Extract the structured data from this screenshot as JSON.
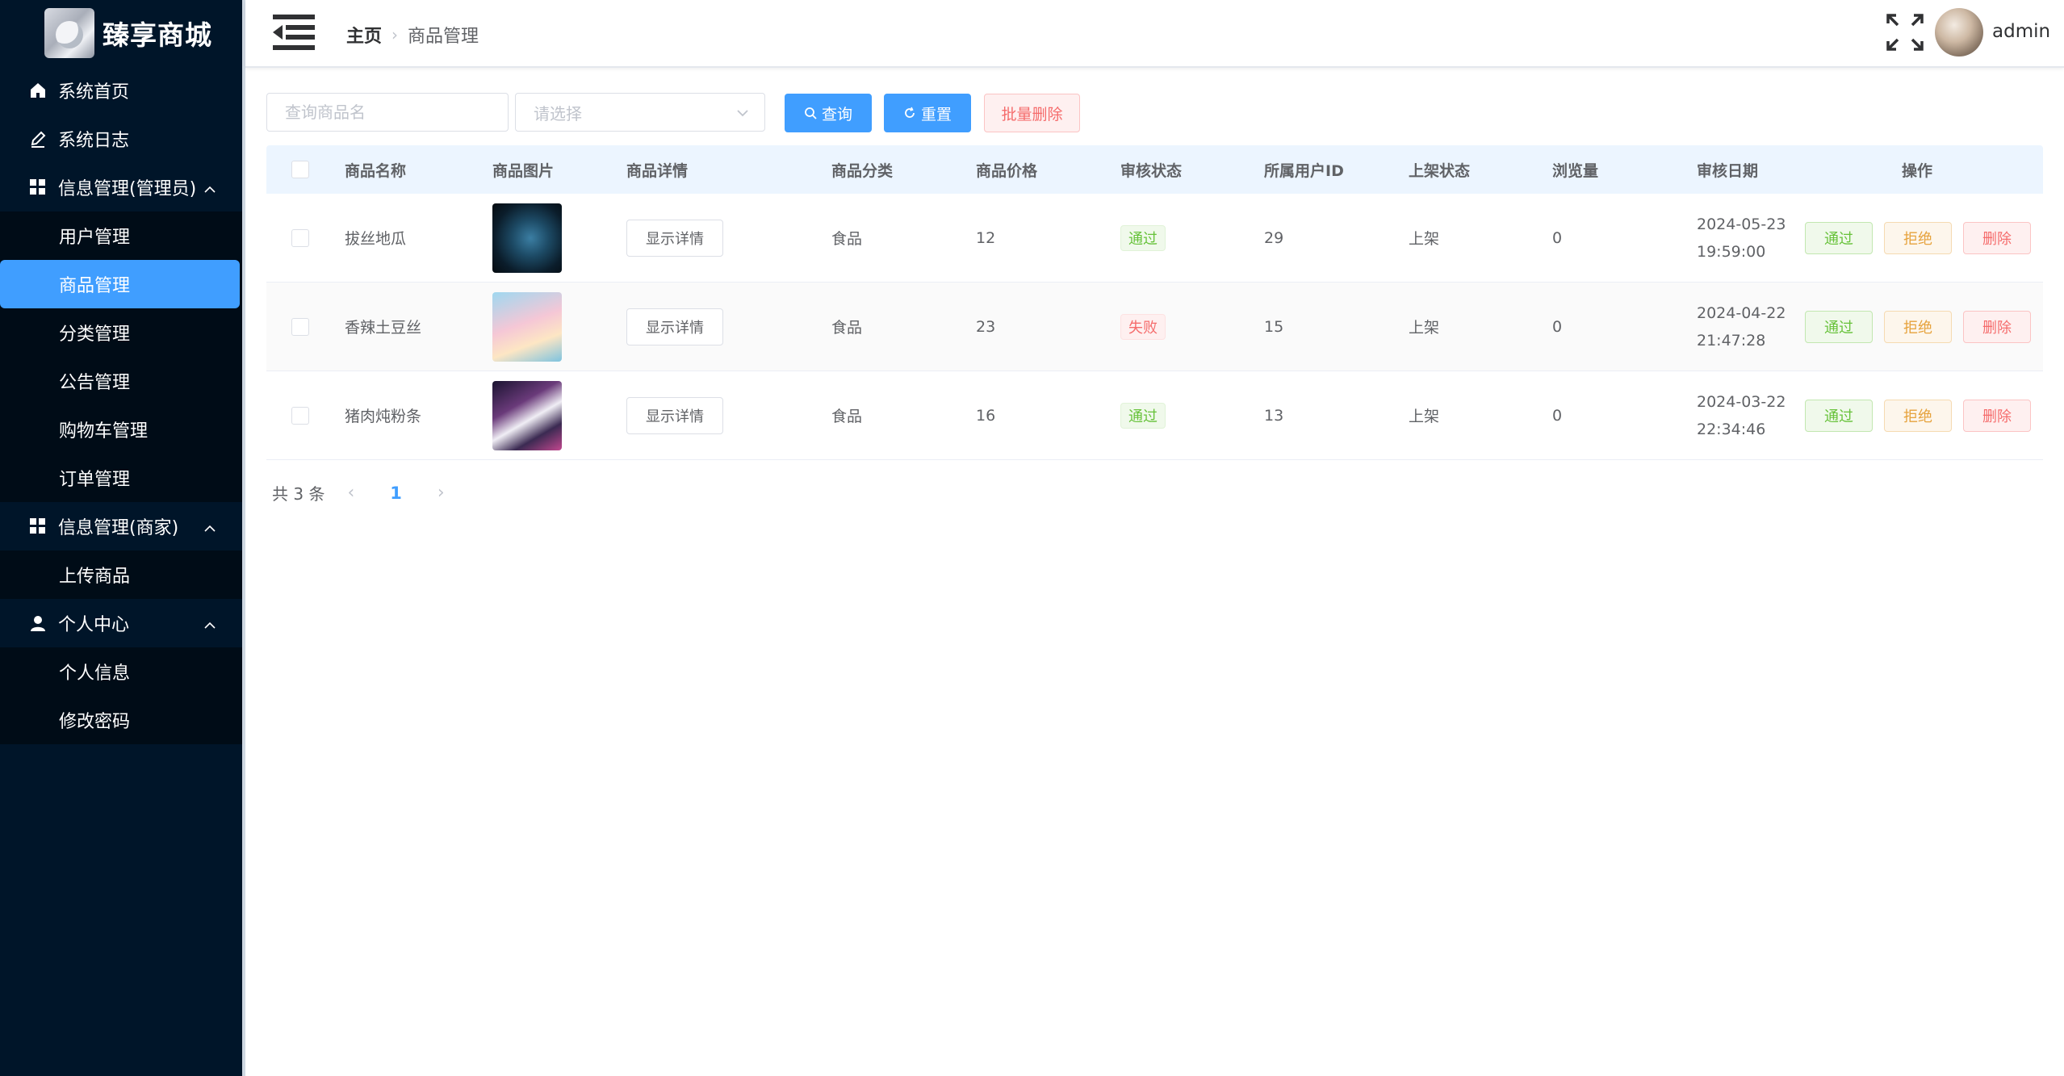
{
  "brand": {
    "title": "臻享商城"
  },
  "sidebar": {
    "items": [
      {
        "label": "系统首页"
      },
      {
        "label": "系统日志"
      }
    ],
    "group_admin": {
      "label": "信息管理(管理员)",
      "items": [
        {
          "label": "用户管理"
        },
        {
          "label": "商品管理"
        },
        {
          "label": "分类管理"
        },
        {
          "label": "公告管理"
        },
        {
          "label": "购物车管理"
        },
        {
          "label": "订单管理"
        }
      ]
    },
    "group_merchant": {
      "label": "信息管理(商家)",
      "items": [
        {
          "label": "上传商品"
        }
      ]
    },
    "group_personal": {
      "label": "个人中心",
      "items": [
        {
          "label": "个人信息"
        },
        {
          "label": "修改密码"
        }
      ]
    }
  },
  "header": {
    "breadcrumb_home": "主页",
    "breadcrumb_current": "商品管理",
    "username": "admin"
  },
  "search": {
    "name_placeholder": "查询商品名",
    "select_placeholder": "请选择",
    "query_label": "查询",
    "reset_label": "重置",
    "batch_delete_label": "批量删除"
  },
  "table": {
    "headers": [
      "商品名称",
      "商品图片",
      "商品详情",
      "商品分类",
      "商品价格",
      "审核状态",
      "所属用户ID",
      "上架状态",
      "浏览量",
      "审核日期",
      "操作"
    ],
    "rows": [
      {
        "name": "拔丝地瓜",
        "detail_label": "显示详情",
        "category": "食品",
        "price": "12",
        "status": "通过",
        "user_id": "29",
        "shelf": "上架",
        "views": "0",
        "date": "2024-05-23",
        "time": "19:59:00"
      },
      {
        "name": "香辣土豆丝",
        "detail_label": "显示详情",
        "category": "食品",
        "price": "23",
        "status": "失败",
        "user_id": "15",
        "shelf": "上架",
        "views": "0",
        "date": "2024-04-22",
        "time": "21:47:28"
      },
      {
        "name": "猪肉炖粉条",
        "detail_label": "显示详情",
        "category": "食品",
        "price": "16",
        "status": "通过",
        "user_id": "13",
        "shelf": "上架",
        "views": "0",
        "date": "2024-03-22",
        "time": "22:34:46"
      }
    ],
    "ops": {
      "pass": "通过",
      "reject": "拒绝",
      "delete": "删除"
    }
  },
  "pagination": {
    "total": "共 3 条",
    "current": "1"
  },
  "colors": {
    "sidebar_bg": "#001529",
    "accent": "#409eff",
    "success": "#67c23a",
    "warning": "#e6a23c",
    "danger": "#f56c6c"
  }
}
